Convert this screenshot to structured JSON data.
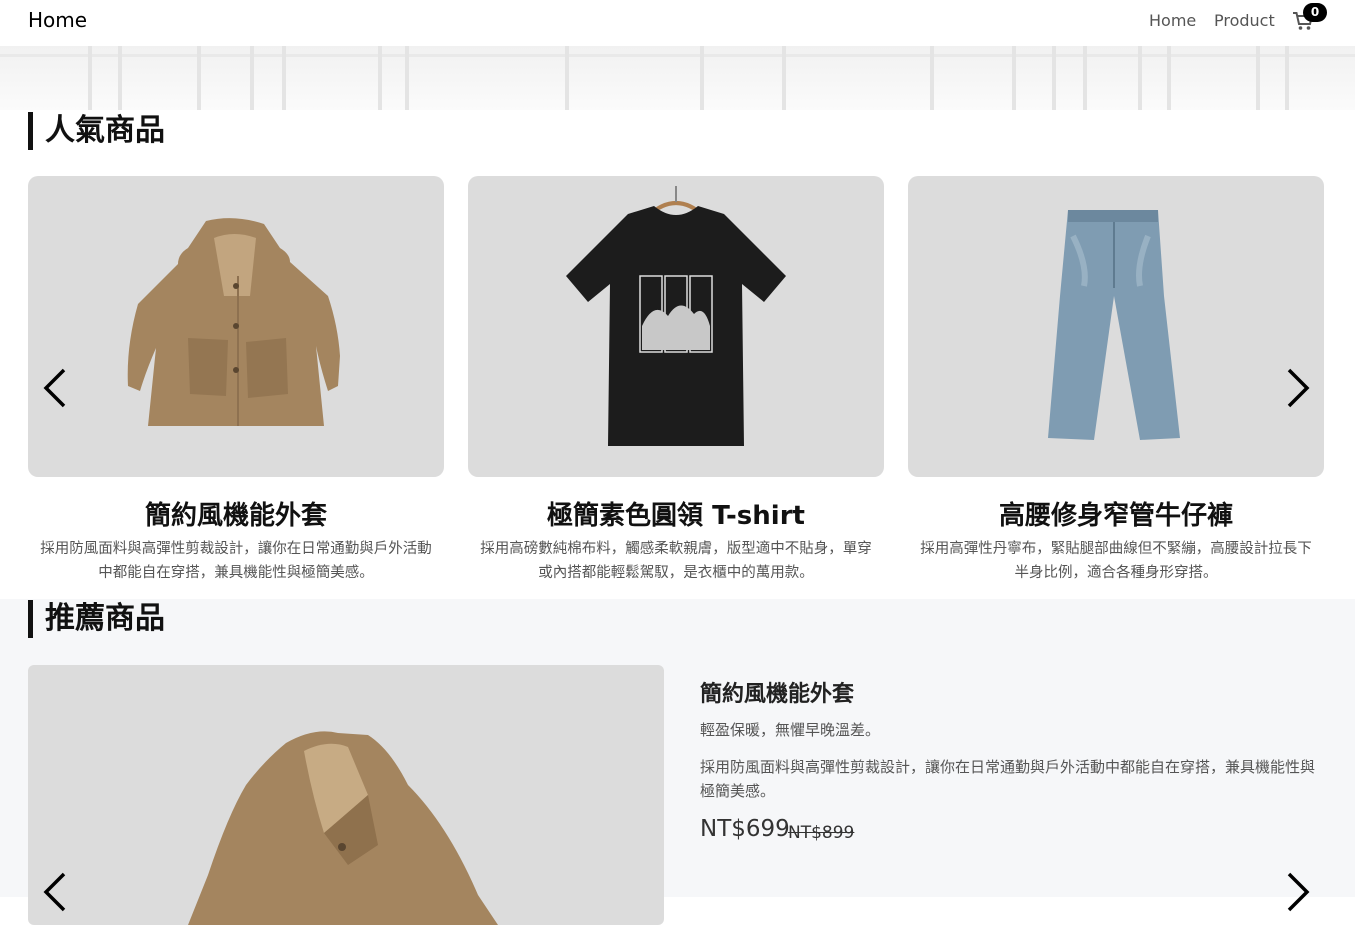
{
  "navbar": {
    "brand": "Home",
    "links": [
      "Home",
      "Product"
    ],
    "cart_count": "0",
    "cart_icon": "shopping-cart-icon"
  },
  "popular": {
    "title": "人氣商品",
    "products": [
      {
        "name": "簡約風機能外套",
        "desc": "採用防風面料與高彈性剪裁設計，讓你在日常通勤與戶外活動中都能自在穿搭，兼具機能性與極簡美感。"
      },
      {
        "name": "極簡素色圓領 T-shirt",
        "desc": "採用高磅數純棉布料，觸感柔軟親膚，版型適中不貼身，單穿或內搭都能輕鬆駕馭，是衣櫃中的萬用款。"
      },
      {
        "name": "高腰修身窄管牛仔褲",
        "desc": "採用高彈性丹寧布，緊貼腿部曲線但不緊繃，高腰設計拉長下半身比例，適合各種身形穿搭。"
      }
    ],
    "prev_icon": "chevron-left-icon",
    "next_icon": "chevron-right-icon"
  },
  "recommended": {
    "title": "推薦商品",
    "product": {
      "name": "簡約風機能外套",
      "subtitle": "輕盈保暖，無懼早晚溫差。",
      "desc": "採用防風面料與高彈性剪裁設計，讓你在日常通勤與戶外活動中都能自在穿搭，兼具機能性與極簡美感。",
      "price": "NT$699",
      "original_price": "NT$899"
    }
  },
  "colors": {
    "card_bg": "#dcdcdc",
    "section_alt_bg": "#f6f7f9",
    "coat": "#a4855f",
    "tee": "#1c1c1c",
    "jeans": "#7f9cb2"
  }
}
